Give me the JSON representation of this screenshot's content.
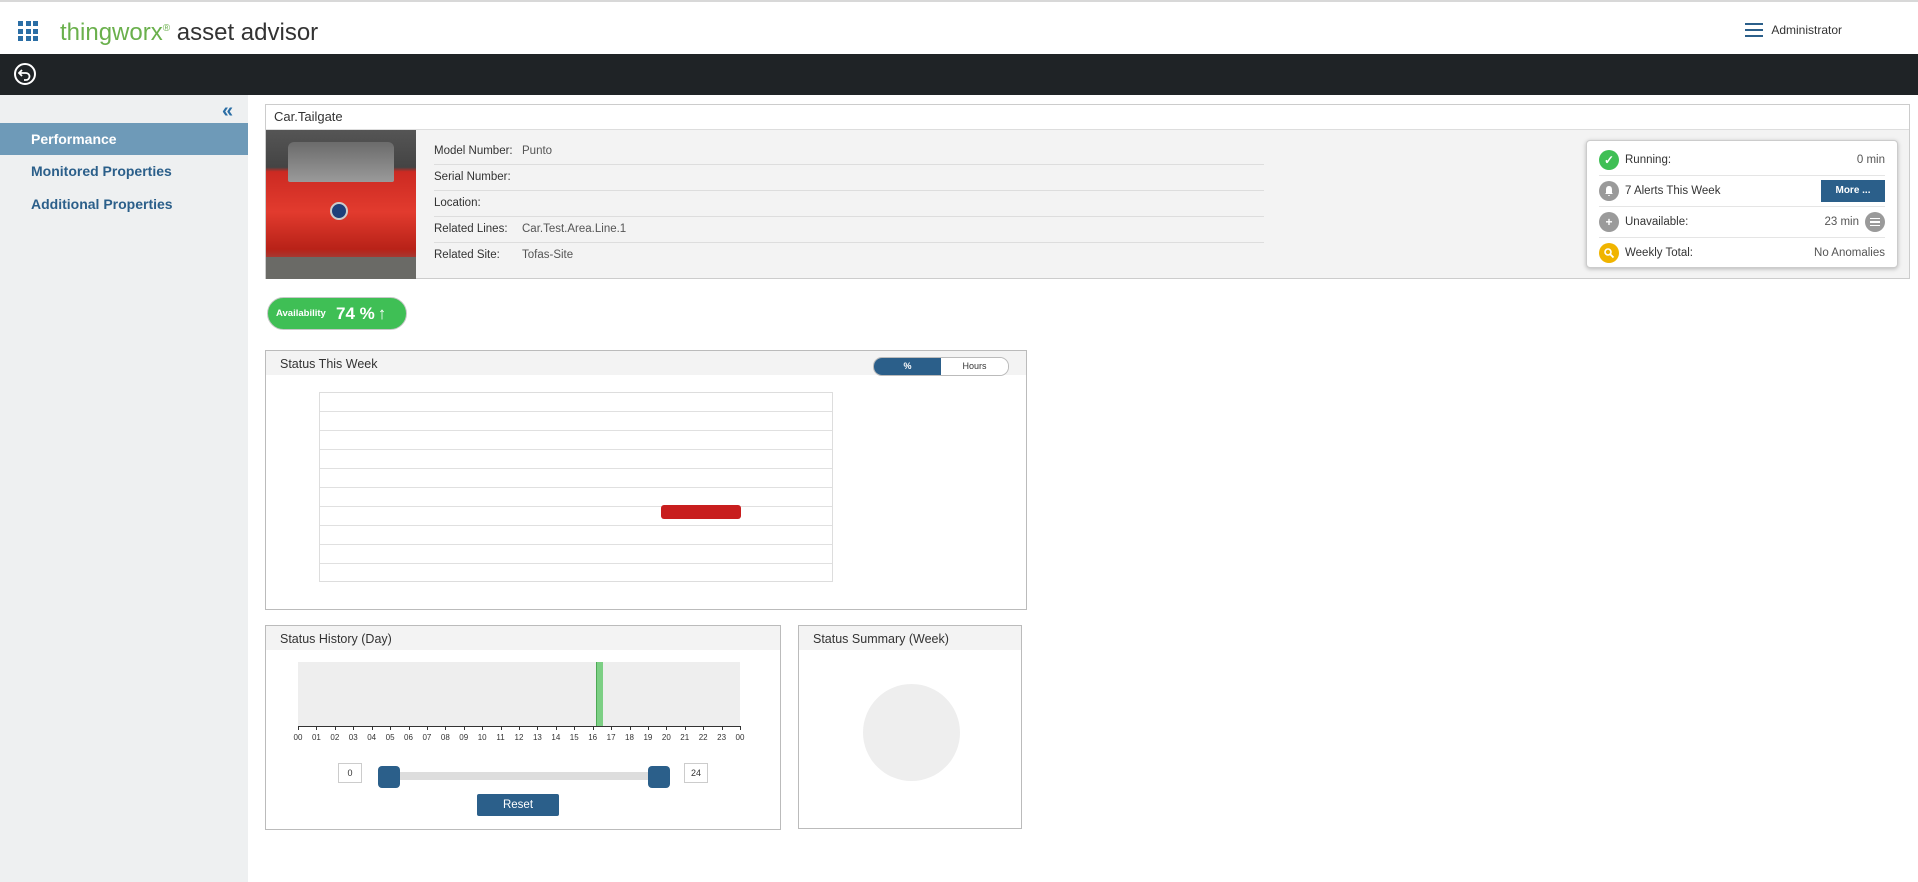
{
  "app": {
    "brand_thingworx": "thingworx",
    "brand_registered": "®",
    "brand_product": "asset advisor",
    "user_label": "Administrator"
  },
  "sidebar": {
    "collapse_glyph": "«",
    "items": [
      {
        "label": "Performance",
        "active": true
      },
      {
        "label": "Monitored Properties",
        "active": false
      },
      {
        "label": "Additional Properties",
        "active": false
      }
    ]
  },
  "asset": {
    "title": "Car.Tailgate",
    "properties": [
      {
        "label": "Model Number:",
        "value": "Punto"
      },
      {
        "label": "Serial Number:",
        "value": ""
      },
      {
        "label": "Location:",
        "value": ""
      },
      {
        "label": "Related Lines:",
        "value": "Car.Test.Area.Line.1"
      },
      {
        "label": "Related Site:",
        "value": "Tofas-Site"
      }
    ]
  },
  "status_card": {
    "running_label": "Running:",
    "running_value": "0 min",
    "alerts_label": "7 Alerts This Week",
    "more_label": "More ...",
    "unavailable_label": "Unavailable:",
    "unavailable_value": "23 min",
    "weekly_label": "Weekly Total:",
    "weekly_value": "No Anomalies",
    "colors": {
      "running": "#3fbf55",
      "alerts": "#9a9a9a",
      "unavailable": "#9a9a9a",
      "weekly": "#f0b400"
    }
  },
  "availability": {
    "label": "Availability",
    "value": "74 %",
    "arrow": "↑"
  },
  "status_week": {
    "title": "Status This Week",
    "toggle_percent": "%",
    "toggle_hours": "Hours",
    "selected": "%"
  },
  "status_history": {
    "title": "Status History (Day)",
    "ticks": [
      "00",
      "01",
      "02",
      "03",
      "04",
      "05",
      "06",
      "07",
      "08",
      "09",
      "10",
      "11",
      "12",
      "13",
      "14",
      "15",
      "16",
      "17",
      "18",
      "19",
      "20",
      "21",
      "22",
      "23",
      "00"
    ],
    "range_min": "0",
    "range_max": "24",
    "reset_label": "Reset"
  },
  "status_summary": {
    "title": "Status Summary (Week)"
  }
}
